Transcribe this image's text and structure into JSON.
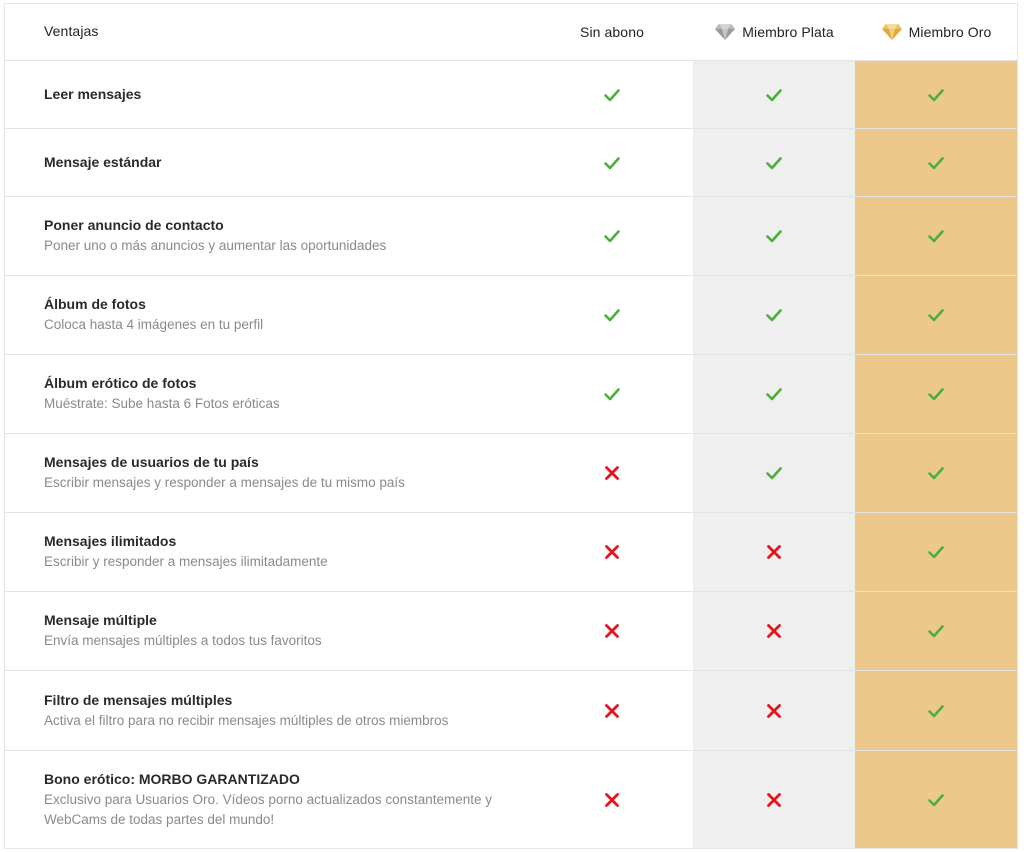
{
  "colors": {
    "check": "#4caf3a",
    "cross": "#e8121c",
    "silver_column": "#efefef",
    "gold_column": "#ecc98b",
    "silver_gem": "#9a9a9a",
    "gold_gem": "#e0a93a"
  },
  "header": {
    "feature_label": "Ventajas",
    "plans": [
      {
        "label": "Sin abono",
        "icon": null
      },
      {
        "label": "Miembro Plata",
        "icon": "silver-diamond-icon"
      },
      {
        "label": "Miembro Oro",
        "icon": "gold-diamond-icon"
      }
    ]
  },
  "features": [
    {
      "title": "Leer mensajes",
      "desc": "",
      "free": "check",
      "silver": "check",
      "gold": "check"
    },
    {
      "title": "Mensaje estándar",
      "desc": "",
      "free": "check",
      "silver": "check",
      "gold": "check"
    },
    {
      "title": "Poner anuncio de contacto",
      "desc": "Poner uno o más anuncios y aumentar las oportunidades",
      "free": "check",
      "silver": "check",
      "gold": "check"
    },
    {
      "title": "Álbum de fotos",
      "desc": "Coloca hasta 4 imágenes en tu perfil",
      "free": "check",
      "silver": "check",
      "gold": "check"
    },
    {
      "title": "Álbum erótico de fotos",
      "desc": "Muéstrate: Sube hasta 6 Fotos eróticas",
      "free": "check",
      "silver": "check",
      "gold": "check"
    },
    {
      "title": "Mensajes de usuarios de tu país",
      "desc": "Escribir mensajes y responder a mensajes de tu mismo país",
      "free": "cross",
      "silver": "check",
      "gold": "check"
    },
    {
      "title": "Mensajes ilimitados",
      "desc": "Escribir y responder a mensajes ilimitadamente",
      "free": "cross",
      "silver": "cross",
      "gold": "check"
    },
    {
      "title": "Mensaje múltiple",
      "desc": "Envía mensajes múltiples a todos tus favoritos",
      "free": "cross",
      "silver": "cross",
      "gold": "check"
    },
    {
      "title": "Filtro de mensajes múltiples",
      "desc": "Activa el filtro para no recibir mensajes múltiples de otros miembros",
      "free": "cross",
      "silver": "cross",
      "gold": "check"
    },
    {
      "title": "Bono erótico: MORBO GARANTIZADO",
      "desc": "Exclusivo para Usuarios Oro. Vídeos porno actualizados constantemente y WebCams de todas partes del mundo!",
      "free": "cross",
      "silver": "cross",
      "gold": "check"
    }
  ]
}
